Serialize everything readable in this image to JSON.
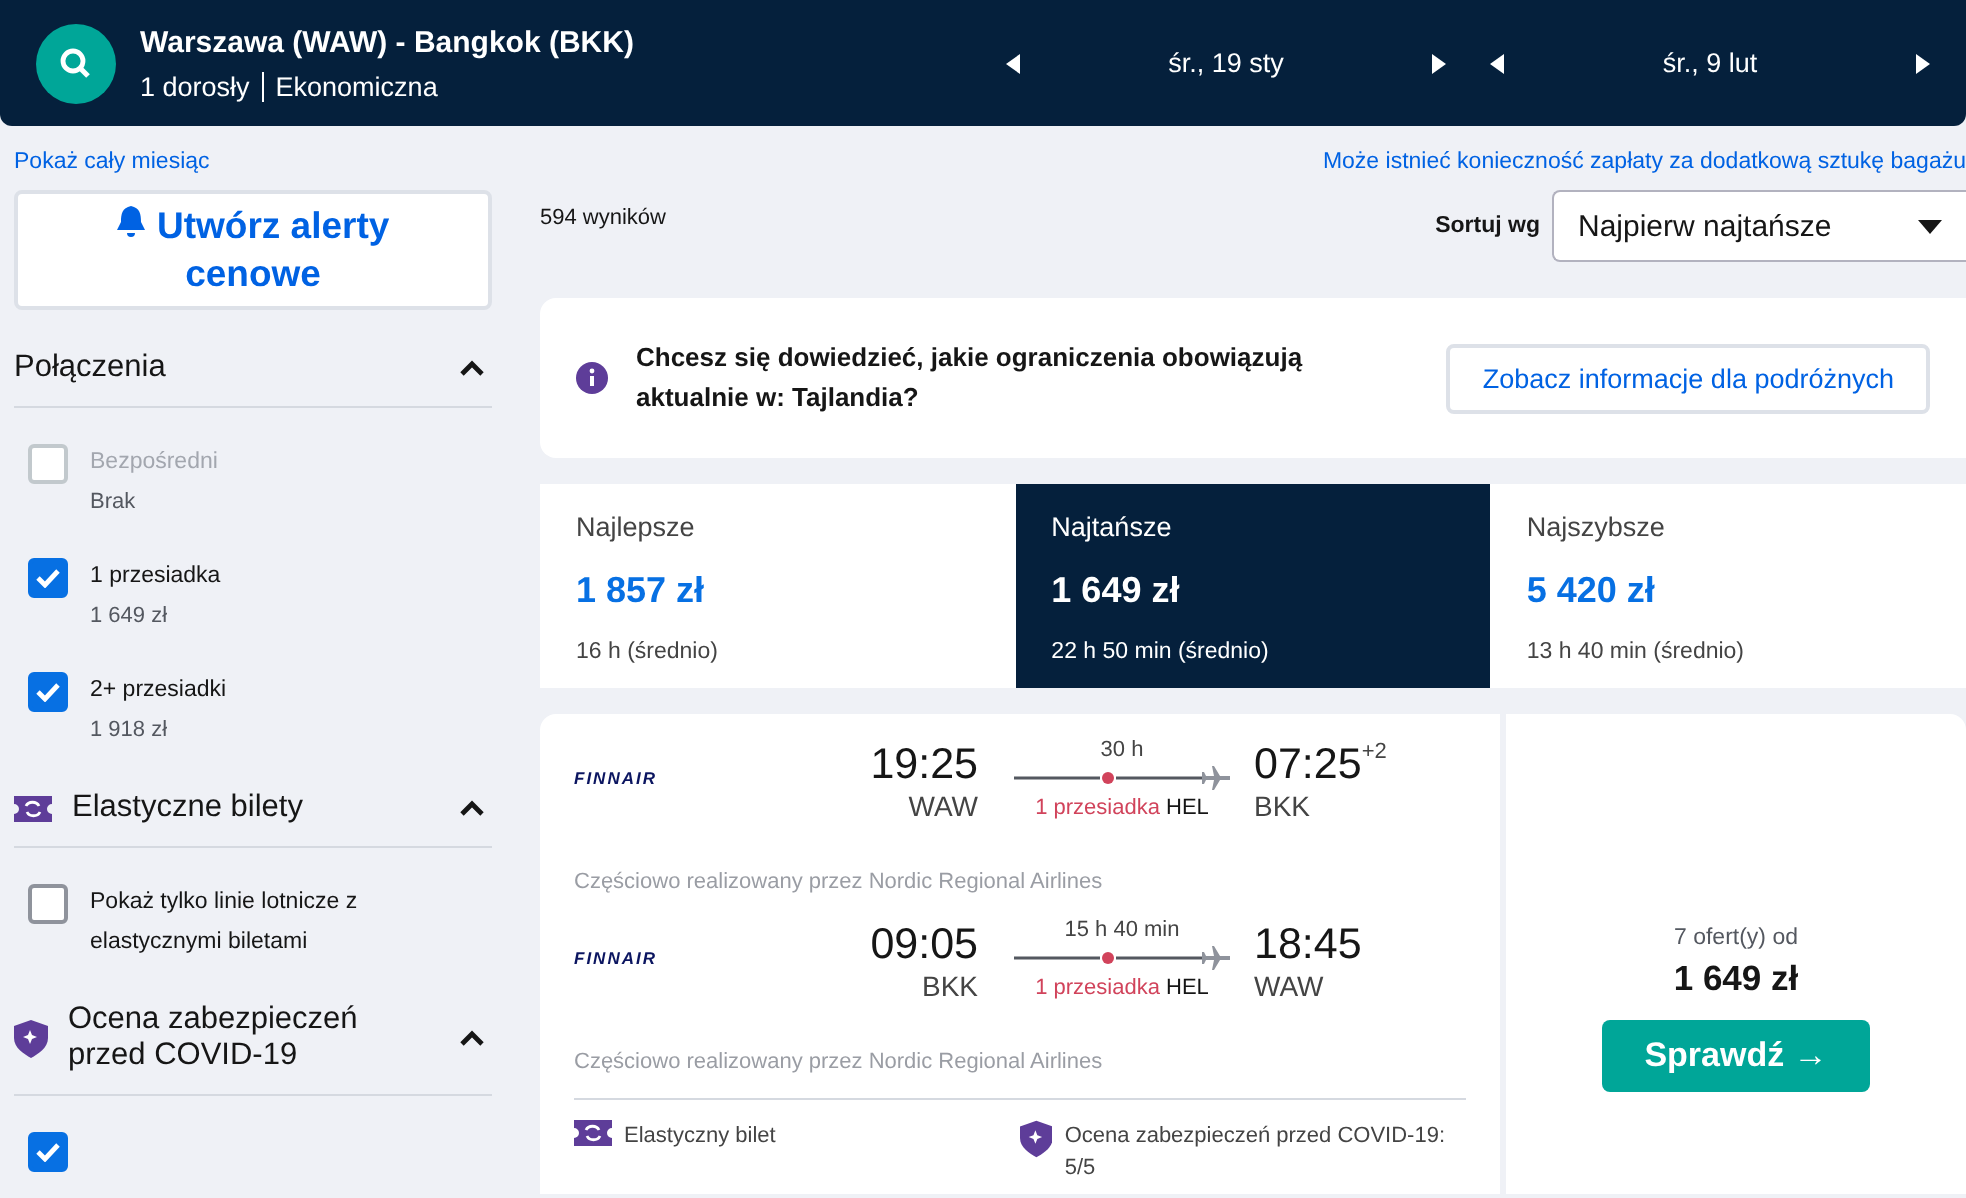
{
  "header": {
    "route": "Warszawa (WAW) - Bangkok (BKK)",
    "travellers": "1 dorosły",
    "cabin": "Ekonomiczna",
    "dates": [
      {
        "label": "śr., 19 sty"
      },
      {
        "label": "śr., 9 lut"
      }
    ]
  },
  "links": {
    "month": "Pokaż cały miesiąc",
    "baggage": "Może istnieć konieczność zapłaty za dodatkową sztukę bagażu"
  },
  "sidebar": {
    "alert_button": "Utwórz alerty cenowe",
    "sections": [
      {
        "kind": "stops",
        "title": "Połączenia",
        "expanded": true,
        "options": [
          {
            "label": "Bezpośredni",
            "price": "Brak",
            "checked": false,
            "disabled": true
          },
          {
            "label": "1 przesiadka",
            "price": "1 649 zł",
            "checked": true,
            "disabled": false
          },
          {
            "label": "2+ przesiadki",
            "price": "1 918 zł",
            "checked": true,
            "disabled": false
          }
        ]
      },
      {
        "kind": "flexible",
        "title": "Elastyczne bilety",
        "expanded": true,
        "options": [
          {
            "label": "Pokaż tylko linie lotnicze z elastycznymi biletami",
            "checked": false,
            "disabled": false
          }
        ]
      },
      {
        "kind": "covid",
        "title": "Ocena zabezpieczeń przed COVID-19",
        "expanded": true,
        "options": [
          {
            "checked": true,
            "disabled": false
          }
        ]
      }
    ]
  },
  "results": {
    "count": "594 wyników",
    "sort_label": "Sortuj wg",
    "sort_value": "Najpierw najtańsze"
  },
  "banner": {
    "text": "Chcesz się dowiedzieć, jakie ograniczenia obowiązują aktualnie w: Tajlandia?",
    "button": "Zobacz informacje dla podróżnych"
  },
  "tabs": [
    {
      "label": "Najlepsze",
      "price": "1 857 zł",
      "duration": "16 h (średnio)",
      "selected": false
    },
    {
      "label": "Najtańsze",
      "price": "1 649 zł",
      "duration": "22 h 50 min (średnio)",
      "selected": true
    },
    {
      "label": "Najszybsze",
      "price": "5 420 zł",
      "duration": "13 h 40 min (średnio)",
      "selected": false
    }
  ],
  "result": {
    "legs": [
      {
        "airline": "FINNAIR",
        "depart_time": "19:25",
        "depart_airport": "WAW",
        "duration": "30 h",
        "stops": "1 przesiadka",
        "stop_airport": "HEL",
        "arrive_time": "07:25",
        "day_offset": "+2",
        "arrive_airport": "BKK",
        "operated_by": "Częściowo realizowany przez Nordic Regional Airlines"
      },
      {
        "airline": "FINNAIR",
        "depart_time": "09:05",
        "depart_airport": "BKK",
        "duration": "15 h 40 min",
        "stops": "1 przesiadka",
        "stop_airport": "HEL",
        "arrive_time": "18:45",
        "arrive_airport": "WAW",
        "operated_by": "Częściowo realizowany przez Nordic Regional Airlines"
      }
    ],
    "badges": [
      {
        "kind": "flexible",
        "text": "Elastyczny bilet"
      },
      {
        "kind": "covid",
        "text": "Ocena zabezpieczeń przed COVID-19: 5/5"
      }
    ],
    "offers": "7 ofert(y) od",
    "price": "1 649 zł",
    "button": "Sprawdź →"
  }
}
